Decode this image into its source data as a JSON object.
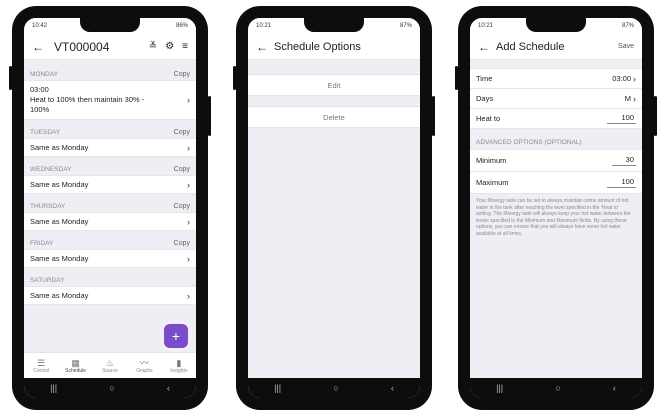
{
  "phone1": {
    "status": {
      "time": "10:42",
      "battery": "86%"
    },
    "title": "VT000004",
    "days": [
      {
        "day": "MONDAY",
        "copy": "Copy",
        "lines": [
          "03:00",
          "Heat to 100% then maintain 30% -",
          "100%"
        ]
      },
      {
        "day": "TUESDAY",
        "copy": "Copy",
        "value": "Same as Monday"
      },
      {
        "day": "WEDNESDAY",
        "copy": "Copy",
        "value": "Same as Monday"
      },
      {
        "day": "THURSDAY",
        "copy": "Copy",
        "value": "Same as Monday"
      },
      {
        "day": "FRIDAY",
        "copy": "Copy",
        "value": "Same as Monday"
      },
      {
        "day": "SATURDAY",
        "copy": "",
        "value": "Same as Monday"
      }
    ],
    "tabs": [
      "Control",
      "Schedule",
      "Source",
      "Graphs",
      "Insights"
    ],
    "fab": "+"
  },
  "phone2": {
    "status": {
      "time": "10:21",
      "battery": "87%"
    },
    "title": "Schedule Options",
    "options": [
      "Edit",
      "Delete"
    ]
  },
  "phone3": {
    "status": {
      "time": "10:21",
      "battery": "87%"
    },
    "title": "Add Schedule",
    "save": "Save",
    "fields": [
      {
        "label": "Time",
        "value": "03:00"
      },
      {
        "label": "Days",
        "value": "M"
      },
      {
        "label": "Heat to",
        "value": "100"
      }
    ],
    "advanced_label": "ADVANCED OPTIONS (OPTIONAL)",
    "advanced": [
      {
        "label": "Minimum",
        "value": "30"
      },
      {
        "label": "Maximum",
        "value": "100"
      }
    ],
    "help": "Your Mixergy tank can be set to always maintain some amount of hot water in the tank after reaching the level specified in the 'Heat to' setting. The Mixergy tank will always keep your hot water between the levels specified in the Minimum and Maximum fields. By using these options, you can ensure that you will always have some hot water available at all times."
  },
  "nav": {
    "recents": "|||",
    "home": "○",
    "back": "‹"
  }
}
